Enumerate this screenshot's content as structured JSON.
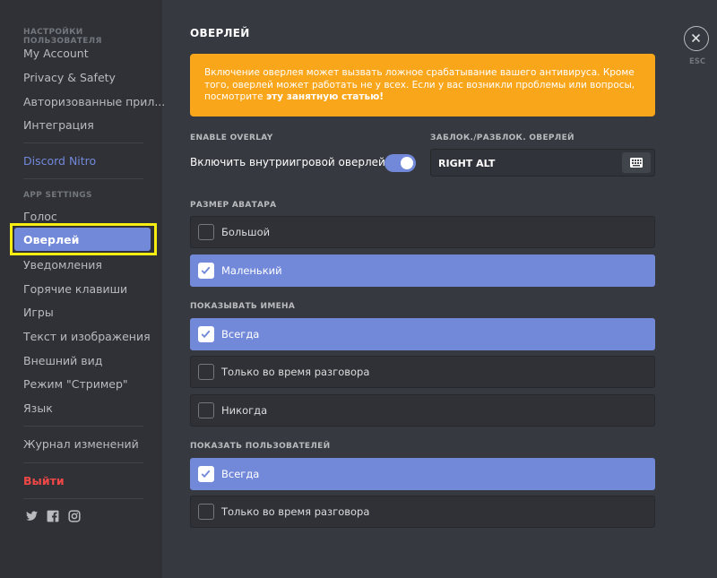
{
  "sidebar": {
    "user_settings_header": "НАСТРОЙКИ ПОЛЬЗОВАТЕЛЯ",
    "user_items": [
      "My Account",
      "Privacy & Safety",
      "Авторизованные прил...",
      "Интеграция"
    ],
    "nitro": "Discord Nitro",
    "app_settings_header": "APP SETTINGS",
    "voice": "Голос",
    "active": "Оверлей",
    "app_items": [
      "Уведомления",
      "Горячие клавиши",
      "Игры",
      "Текст и изображения",
      "Внешний вид",
      "Режим \"Стример\"",
      "Язык"
    ],
    "changelog": "Журнал изменений",
    "logout": "Выйти",
    "social_icons": [
      "twitter-icon",
      "facebook-icon",
      "instagram-icon"
    ]
  },
  "main": {
    "title": "ОВЕРЛЕЙ",
    "warning_text": "Включение оверлея может вызвать ложное срабатывание вашего антивируса. Кроме того, оверлей может работать не у всех. Если у вас возникли проблемы или вопросы, посмотрите ",
    "warning_link": "эту занятную статью!",
    "enable_overlay_label": "ENABLE OVERLAY",
    "enable_overlay_text": "Включить внутриигровой оверлей.",
    "toggle_on": true,
    "keybind_label": "ЗАБЛОК./РАЗБЛОК. ОВЕРЛЕЙ",
    "keybind_value": "RIGHT ALT",
    "avatar_size_label": "РАЗМЕР АВАТАРА",
    "avatar_options": [
      {
        "label": "Большой",
        "selected": false
      },
      {
        "label": "Маленький",
        "selected": true
      }
    ],
    "show_names_label": "ПОКАЗЫВАТЬ ИМЕНА",
    "names_options": [
      {
        "label": "Всегда",
        "selected": true
      },
      {
        "label": "Только во время разговора",
        "selected": false
      },
      {
        "label": "Никогда",
        "selected": false
      }
    ],
    "show_users_label": "ПОКАЗАТЬ ПОЛЬЗОВАТЕЛЕЙ",
    "users_options": [
      {
        "label": "Всегда",
        "selected": true
      },
      {
        "label": "Только во время разговора",
        "selected": false
      }
    ],
    "esc_label": "ESC"
  },
  "colors": {
    "accent": "#7289da",
    "warning": "#faa61a",
    "danger": "#f04747",
    "highlight": "#f7ed12"
  }
}
